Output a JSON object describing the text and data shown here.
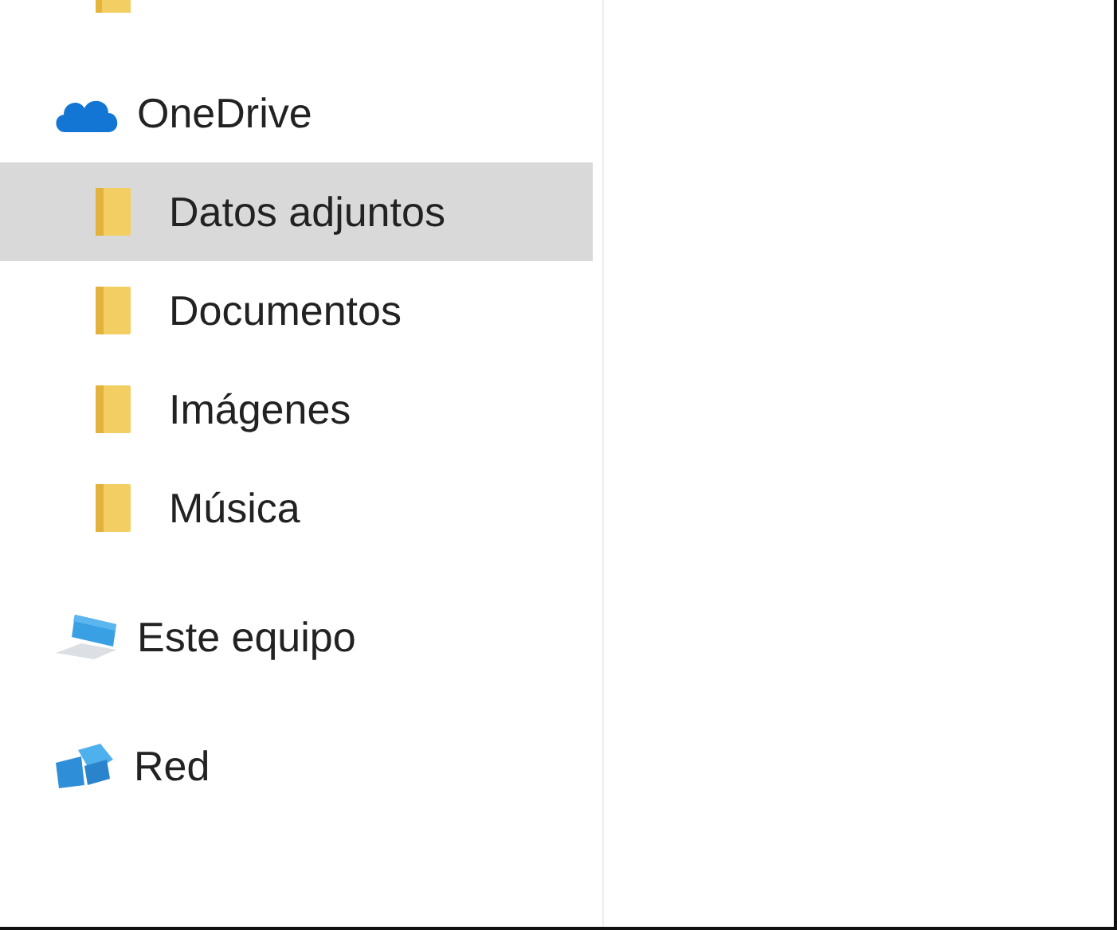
{
  "navigation_pane": {
    "items": [
      {
        "kind": "cloud",
        "label": "OneDrive",
        "selected": false,
        "children": [
          {
            "kind": "folder",
            "label": "Datos adjuntos",
            "selected": true
          },
          {
            "kind": "folder",
            "label": "Documentos",
            "selected": false
          },
          {
            "kind": "folder",
            "label": "Imágenes",
            "selected": false
          },
          {
            "kind": "folder",
            "label": "Música",
            "selected": false
          }
        ]
      },
      {
        "kind": "computer",
        "label": "Este equipo",
        "selected": false
      },
      {
        "kind": "network",
        "label": "Red",
        "selected": false
      }
    ]
  }
}
